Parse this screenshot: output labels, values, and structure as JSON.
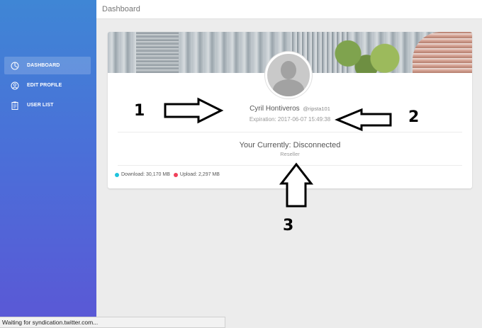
{
  "topbar": {
    "title": "Dashboard"
  },
  "sidebar": {
    "items": [
      {
        "label": "DASHBOARD",
        "icon": "gauge-icon",
        "active": true
      },
      {
        "label": "EDIT PROFILE",
        "icon": "user-circle-icon",
        "active": false
      },
      {
        "label": "USER LIST",
        "icon": "clipboard-icon",
        "active": false
      }
    ]
  },
  "profile": {
    "name": "Cyril Hontiveros",
    "handle": "@ripsta101",
    "expiration": "Expiration: 2017-06-07 15:49:38",
    "status": "Your Currently: Disconnected",
    "role": "Reseller"
  },
  "traffic": {
    "download": "Download: 30,170 MB",
    "upload": "Upload: 2,297 MB",
    "download_color": "#1ec3dd",
    "upload_color": "#f0405a"
  },
  "annotations": {
    "one": "1",
    "two": "2",
    "three": "3"
  },
  "statusbar": {
    "text": "Waiting for syndication.twitter.com..."
  },
  "colors": {
    "sidebar_top": "#3f86d5",
    "sidebar_bottom": "#5b57d6"
  }
}
